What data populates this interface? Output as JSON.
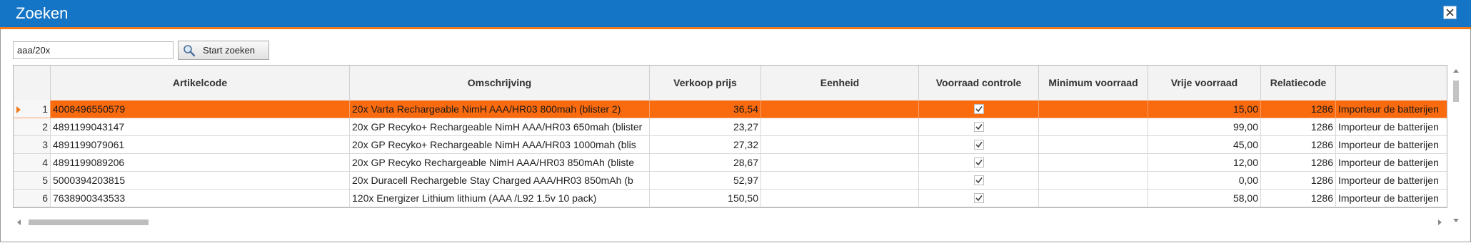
{
  "window": {
    "title": "Zoeken"
  },
  "search": {
    "value": "aaa/20x",
    "button_label": "Start zoeken"
  },
  "columns": [
    "Artikelcode",
    "Omschrijving",
    "Verkoop prijs",
    "Eenheid",
    "Voorraad controle",
    "Minimum voorraad",
    "Vrije voorraad",
    "Relatiecode"
  ],
  "rows": [
    {
      "index": "1",
      "artikelcode": "4008496550579",
      "omschrijving": "20x Varta Rechargeable NimH AAA/HR03 800mah (blister 2)",
      "prijs": "36,54",
      "eenheid": "",
      "voorraad_controle": true,
      "minimum": "",
      "vrije": "15,00",
      "relatiecode": "1286",
      "relatie": "Importeur de batterijen",
      "selected": true
    },
    {
      "index": "2",
      "artikelcode": "4891199043147",
      "omschrijving": "20x GP Recyko+ Rechargeable NimH AAA/HR03 650mah (blister",
      "prijs": "23,27",
      "eenheid": "",
      "voorraad_controle": true,
      "minimum": "",
      "vrije": "99,00",
      "relatiecode": "1286",
      "relatie": "Importeur de batterijen"
    },
    {
      "index": "3",
      "artikelcode": "4891199079061",
      "omschrijving": "20x GP Recyko+ Rechargeable NimH AAA/HR03 1000mah (blis",
      "prijs": "27,32",
      "eenheid": "",
      "voorraad_controle": true,
      "minimum": "",
      "vrije": "45,00",
      "relatiecode": "1286",
      "relatie": "Importeur de batterijen"
    },
    {
      "index": "4",
      "artikelcode": "4891199089206",
      "omschrijving": "20x GP Recyko Rechargeable NimH AAA/HR03 850mAh (bliste",
      "prijs": "28,67",
      "eenheid": "",
      "voorraad_controle": true,
      "minimum": "",
      "vrije": "12,00",
      "relatiecode": "1286",
      "relatie": "Importeur de batterijen"
    },
    {
      "index": "5",
      "artikelcode": "5000394203815",
      "omschrijving": "20x Duracell Rechargeble Stay Charged AAA/HR03 850mAh (b",
      "prijs": "52,97",
      "eenheid": "",
      "voorraad_controle": true,
      "minimum": "",
      "vrije": "0,00",
      "relatiecode": "1286",
      "relatie": "Importeur de batterijen"
    },
    {
      "index": "6",
      "artikelcode": "7638900343533",
      "omschrijving": "120x Energizer Lithium lithium (AAA /L92 1.5v 10 pack)",
      "prijs": "150,50",
      "eenheid": "",
      "voorraad_controle": true,
      "minimum": "",
      "vrije": "58,00",
      "relatiecode": "1286",
      "relatie": "Importeur de batterijen"
    }
  ]
}
